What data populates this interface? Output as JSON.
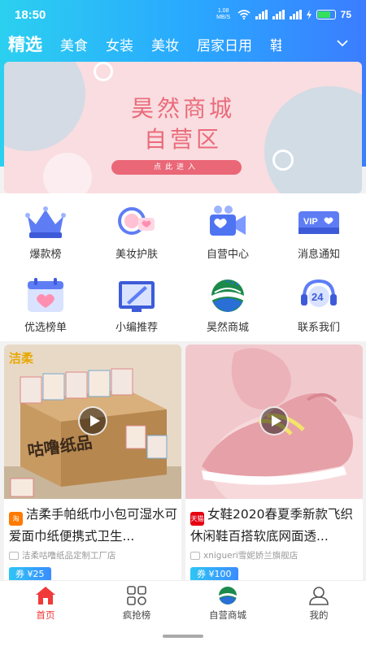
{
  "status": {
    "time": "18:50",
    "net_speed_top": "1.08",
    "net_speed_unit": "MB/S",
    "battery_pct": "75"
  },
  "categories": [
    "精选",
    "美食",
    "女装",
    "美妆",
    "居家日用",
    "鞋"
  ],
  "banner": {
    "line1": "昊然商城",
    "line2": "自营区",
    "button": "点此进入"
  },
  "grid": [
    {
      "label": "爆款榜",
      "icon": "crown-icon"
    },
    {
      "label": "美妆护肤",
      "icon": "cosmetics-icon"
    },
    {
      "label": "自营中心",
      "icon": "video-camera-icon"
    },
    {
      "label": "消息通知",
      "icon": "vip-card-icon"
    },
    {
      "label": "优选榜单",
      "icon": "calendar-heart-icon"
    },
    {
      "label": "小编推荐",
      "icon": "painting-icon"
    },
    {
      "label": "昊然商城",
      "icon": "globe-logo-icon"
    },
    {
      "label": "联系我们",
      "icon": "headset-24-icon"
    }
  ],
  "products": [
    {
      "badge": "淘",
      "title": "洁柔手帕纸巾小包可湿水可爱面巾纸便携式卫生...",
      "shop": "洁柔咕噜纸品定制工厂店",
      "coupon": "券 ¥25",
      "image_text_brand": "洁柔",
      "image_text_box": "咕噜纸品"
    },
    {
      "badge": "天猫",
      "title": "女鞋2020春夏季新款飞织休闲鞋百搭软底网面透...",
      "shop": "xnigueri雪妮娇兰旗舰店",
      "coupon": "券 ¥100"
    }
  ],
  "nav": [
    {
      "label": "首页",
      "icon": "home-icon",
      "active": true
    },
    {
      "label": "疯抢榜",
      "icon": "grid-icon",
      "active": false
    },
    {
      "label": "自营商城",
      "icon": "globe-logo-icon",
      "active": false
    },
    {
      "label": "我的",
      "icon": "user-icon",
      "active": false
    }
  ],
  "colors": {
    "accent": "#2aa6ff",
    "active_nav": "#f03a3a",
    "banner_pink": "#ea6b7b"
  }
}
